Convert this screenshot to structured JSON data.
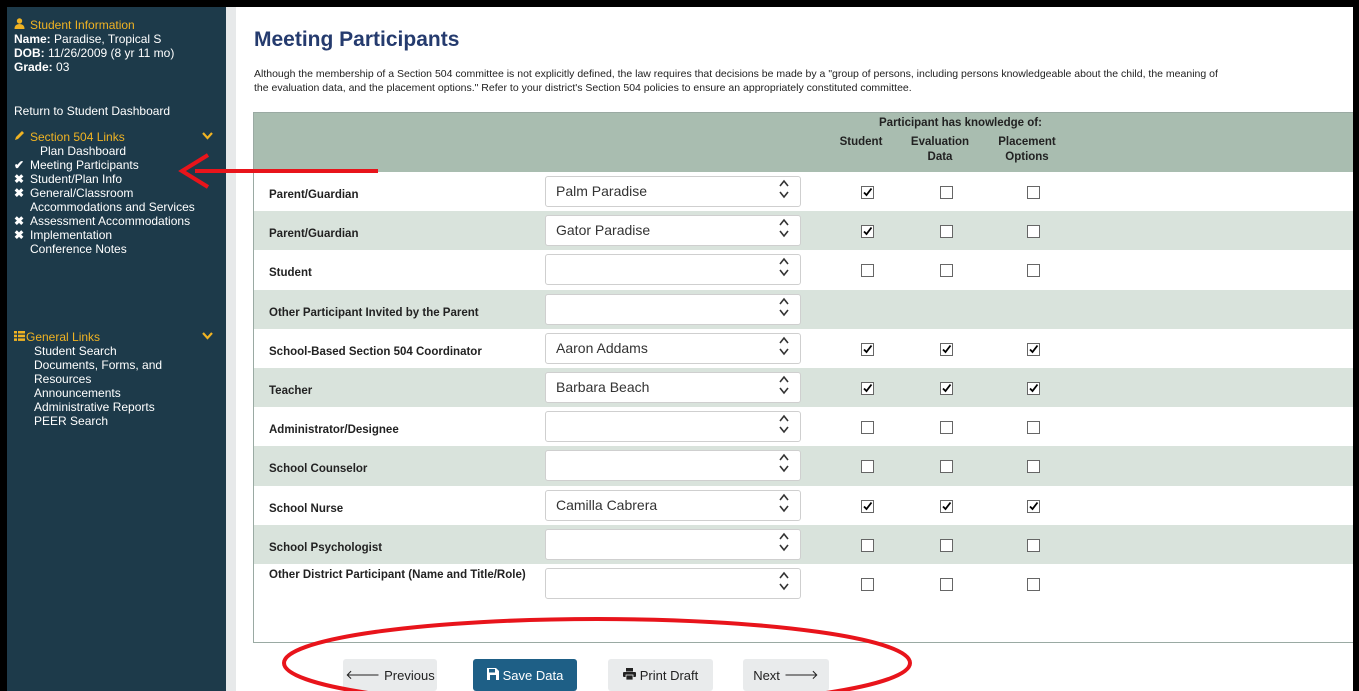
{
  "student_info": {
    "header": "Student Information",
    "name_label": "Name:",
    "name_value": "Paradise, Tropical S",
    "dob_label": "DOB:",
    "dob_value": "11/26/2009 (8 yr 11 mo)",
    "grade_label": "Grade:",
    "grade_value": "03"
  },
  "return_link": "Return to Student Dashboard",
  "section504": {
    "header": "Section 504 Links",
    "plan_dashboard": "Plan Dashboard",
    "items": [
      {
        "label": "Meeting Participants",
        "status": "check"
      },
      {
        "label": "Student/Plan Info",
        "status": "x"
      },
      {
        "label": "General/Classroom",
        "status": "x"
      },
      {
        "label": "Accommodations and Services",
        "status": "none"
      },
      {
        "label": "Assessment Accommodations",
        "status": "x"
      },
      {
        "label": "Implementation",
        "status": "x"
      },
      {
        "label": "Conference Notes",
        "status": "none"
      }
    ]
  },
  "general_links": {
    "header": "General Links",
    "items": [
      "Student Search",
      "Documents, Forms, and",
      "Resources",
      "Announcements",
      "Administrative Reports",
      "PEER Search"
    ]
  },
  "page": {
    "title": "Meeting Participants",
    "intro_line1": "Although the membership of a Section 504 committee is not explicitly defined, the law requires that decisions be made by a \"group of persons, including persons knowledgeable about the child, the meaning of",
    "intro_line2": "the evaluation data, and the placement options.\" Refer to your district's Section 504 policies to ensure an appropriately constituted committee."
  },
  "table": {
    "span_header": "Participant has knowledge of:",
    "columns": [
      {
        "line1": "Student",
        "line2": ""
      },
      {
        "line1": "Evaluation",
        "line2": "Data"
      },
      {
        "line1": "Placement",
        "line2": "Options"
      }
    ],
    "rows": [
      {
        "role": "Parent/Guardian",
        "name": "Palm Paradise",
        "checks": [
          true,
          false,
          false
        ]
      },
      {
        "role": "Parent/Guardian",
        "name": "Gator Paradise",
        "checks": [
          true,
          false,
          false
        ]
      },
      {
        "role": "Student",
        "name": "",
        "checks": [
          false,
          false,
          false
        ]
      },
      {
        "role": "Other Participant Invited by the Parent",
        "name": "",
        "checks": null
      },
      {
        "role": "School-Based Section 504 Coordinator",
        "name": "Aaron Addams",
        "checks": [
          true,
          true,
          true
        ]
      },
      {
        "role": "Teacher",
        "name": "Barbara Beach",
        "checks": [
          true,
          true,
          true
        ]
      },
      {
        "role": "Administrator/Designee",
        "name": "",
        "checks": [
          false,
          false,
          false
        ]
      },
      {
        "role": "School Counselor",
        "name": "",
        "checks": [
          false,
          false,
          false
        ]
      },
      {
        "role": "School Nurse",
        "name": "Camilla Cabrera",
        "checks": [
          true,
          true,
          true
        ]
      },
      {
        "role": "School Psychologist",
        "name": "",
        "checks": [
          false,
          false,
          false
        ]
      },
      {
        "role": "Other District Participant (Name and Title/Role)",
        "name": "",
        "checks": [
          false,
          false,
          false
        ]
      }
    ]
  },
  "buttons": {
    "previous": "Previous",
    "save": "Save Data",
    "print": "Print Draft",
    "next": "Next"
  },
  "colors": {
    "sidebar_bg": "#1d3a4a",
    "accent": "#f0b323",
    "title": "#253b6e",
    "header_row": "#a9bdb0",
    "alt_row": "#d9e3dc",
    "primary_button": "#1e5f86",
    "annotation": "#e8141b"
  },
  "icons": {
    "student_info": "person-icon",
    "section504": "pencil-icon",
    "general_links": "list-icon",
    "check": "check-icon",
    "x": "x-icon",
    "save": "floppy-disk-icon",
    "print": "printer-icon"
  }
}
